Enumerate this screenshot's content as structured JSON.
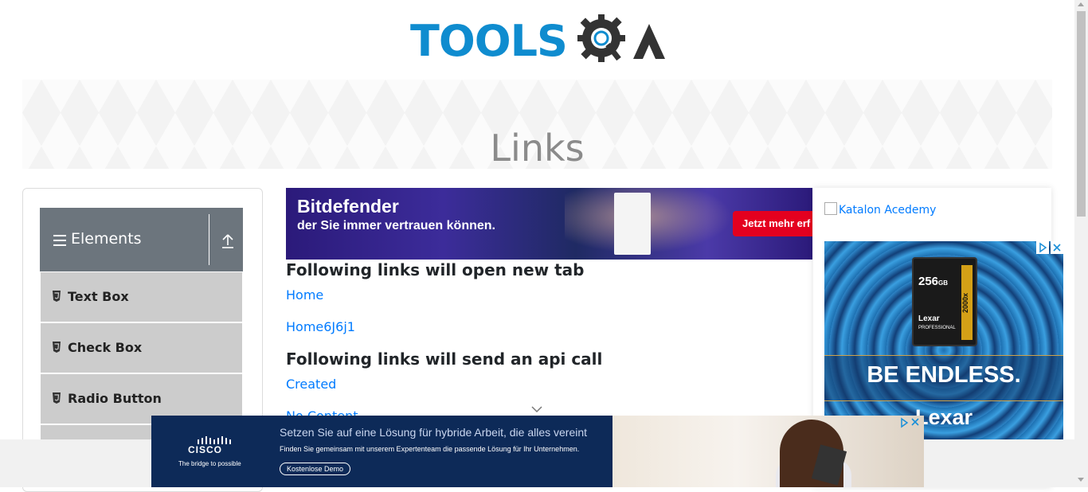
{
  "header": {
    "logo_text": "TOOLS",
    "logo_text_2": "QA"
  },
  "banner": {
    "title": "Links"
  },
  "sidebar": {
    "group": {
      "label": "Elements"
    },
    "items": [
      {
        "label": "Text Box"
      },
      {
        "label": "Check Box"
      },
      {
        "label": "Radio Button"
      }
    ]
  },
  "top_ad": {
    "brand": "Bitdefender",
    "tagline": "der Sie immer vertrauen können.",
    "cta": "Jetzt mehr erf"
  },
  "main": {
    "section1_title": "Following links will open new tab",
    "link_home": "Home",
    "link_dynamic": "Home6J6j1",
    "section2_title": "Following links will send an api call",
    "link_created": "Created",
    "link_no_content": "No Content"
  },
  "right": {
    "katalon_alt": "Katalon Acedemy",
    "ad": {
      "capacity": "256",
      "capacity_unit": "GB",
      "speed": "2000x",
      "card_brand": "Lexar",
      "card_sub": "PROFESSIONAL",
      "slogan": "BE ENDLESS.",
      "brand": "Lexar"
    }
  },
  "bottom_ad": {
    "brand": "CISCO",
    "brand_tagline": "The bridge to possible",
    "headline": "Setzen Sie auf eine Lösung für hybride Arbeit, die alles vereint",
    "subline": "Finden Sie gemeinsam mit unserem Expertenteam die passende Lösung für Ihr Unternehmen.",
    "cta": "Kostenlose Demo"
  },
  "colors": {
    "brand_blue": "#0f8ccf",
    "header_gray": "#6c757d",
    "menu_gray": "#cccccc",
    "link_blue": "#007bff"
  }
}
